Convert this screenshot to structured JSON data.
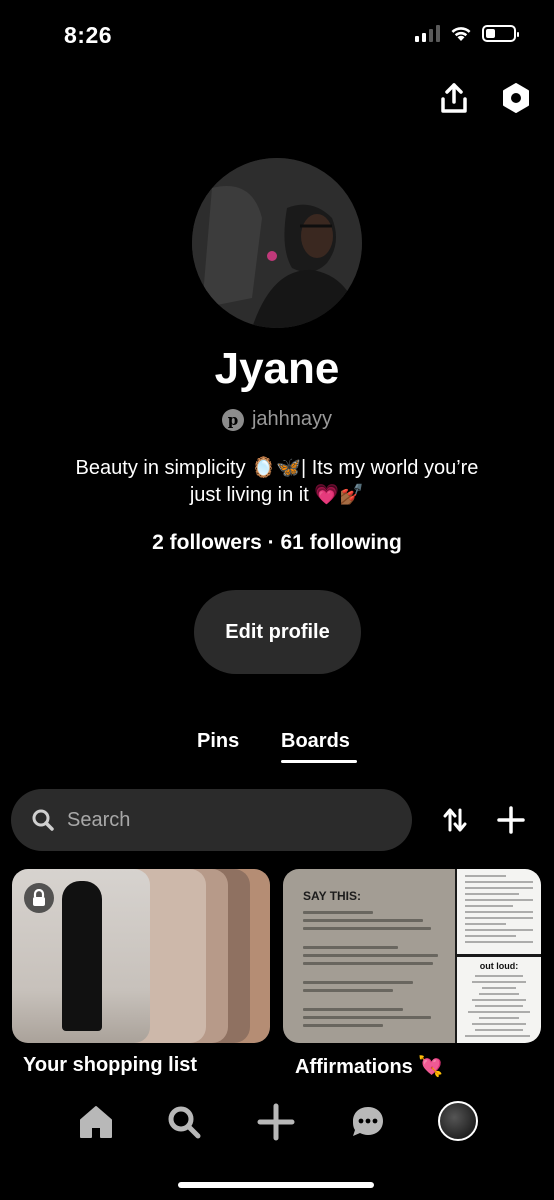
{
  "status_bar": {
    "time": "8:26"
  },
  "header": {
    "share_icon": "share-upload-icon",
    "settings_icon": "settings-hexagon-icon"
  },
  "profile": {
    "name": "Jyane",
    "handle": "jahhnayy",
    "bio_line1": "Beauty in simplicity 🪞🦋| Its my world you’re",
    "bio_line2": "just living in it 💗💅🏾",
    "stats": "2 followers · 61 following",
    "edit_button": "Edit profile"
  },
  "tabs": [
    {
      "label": "Pins",
      "active": false
    },
    {
      "label": "Boards",
      "active": true
    }
  ],
  "search": {
    "placeholder": "Search"
  },
  "boards": [
    {
      "title": "Your shopping list",
      "locked": true
    },
    {
      "title": "Affirmations 💘",
      "preview_heading": "SAY THIS:",
      "preview_side": "out loud:"
    }
  ],
  "bottom_nav": [
    "home-icon",
    "search-icon",
    "create-plus-icon",
    "messages-icon",
    "profile-avatar"
  ],
  "colors": {
    "background": "#000000",
    "surface": "#2b2b2b",
    "text": "#ffffff",
    "muted": "#9a9a9a"
  }
}
